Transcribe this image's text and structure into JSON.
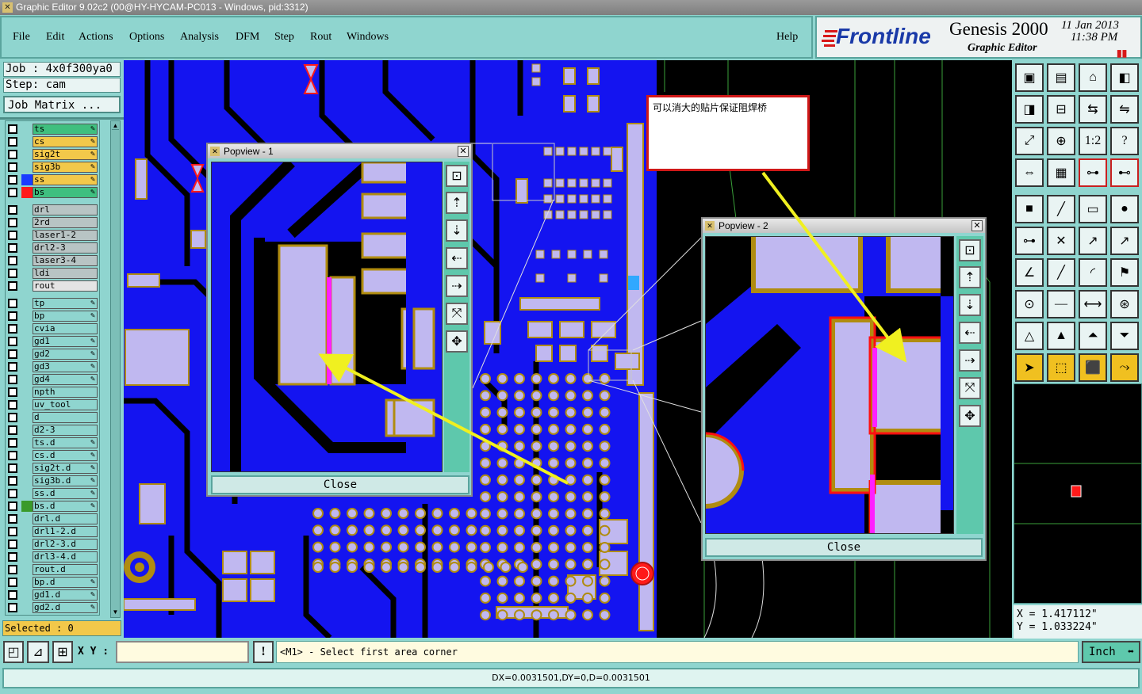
{
  "window_title": "Graphic Editor 9.02c2 (00@HY-HYCAM-PC013 - Windows, pid:3312)",
  "menu": [
    "File",
    "Edit",
    "Actions",
    "Options",
    "Analysis",
    "DFM",
    "Step",
    "Rout",
    "Windows"
  ],
  "help_label": "Help",
  "brand": {
    "logo": "Frontline",
    "product": "Genesis 2000",
    "subtitle": "Graphic Editor",
    "date": "11 Jan 2013",
    "time": "11:38 PM"
  },
  "job": "Job : 4x0f300ya0",
  "step": "Step: cam",
  "job_matrix_label": "Job Matrix ...",
  "layers": [
    {
      "name": "ts",
      "bg": "#3fbf7f",
      "sw": "",
      "ed": true
    },
    {
      "name": "cs",
      "bg": "#f2c84a",
      "sw": "",
      "ed": true
    },
    {
      "name": "sig2t",
      "bg": "#f2c84a",
      "sw": "",
      "ed": true
    },
    {
      "name": "sig3b",
      "bg": "#f2c84a",
      "sw": "",
      "ed": true
    },
    {
      "name": "ss",
      "bg": "#f2c84a",
      "sw": "#1a3cff",
      "ed": true
    },
    {
      "name": "bs",
      "bg": "#3fbf7f",
      "sw": "#ff1a1a",
      "ed": true
    },
    {
      "name": "drl",
      "bg": "#b8c4c4",
      "sw": "",
      "ed": false,
      "gap": true
    },
    {
      "name": "2rd",
      "bg": "#b8c4c4",
      "sw": "",
      "ed": false
    },
    {
      "name": "laser1-2",
      "bg": "#b8c4c4",
      "sw": "",
      "ed": false
    },
    {
      "name": "drl2-3",
      "bg": "#b8c4c4",
      "sw": "",
      "ed": false
    },
    {
      "name": "laser3-4",
      "bg": "#b8c4c4",
      "sw": "",
      "ed": false
    },
    {
      "name": "ldi",
      "bg": "#b8c4c4",
      "sw": "",
      "ed": false
    },
    {
      "name": "rout",
      "bg": "#e4e4e4",
      "sw": "",
      "ed": false
    },
    {
      "name": "tp",
      "bg": "#8fd5cf",
      "sw": "",
      "ed": true,
      "gap": true
    },
    {
      "name": "bp",
      "bg": "#8fd5cf",
      "sw": "",
      "ed": true
    },
    {
      "name": "cvia",
      "bg": "#8fd5cf",
      "sw": "",
      "ed": false
    },
    {
      "name": "gd1",
      "bg": "#8fd5cf",
      "sw": "",
      "ed": true
    },
    {
      "name": "gd2",
      "bg": "#8fd5cf",
      "sw": "",
      "ed": true
    },
    {
      "name": "gd3",
      "bg": "#8fd5cf",
      "sw": "",
      "ed": true
    },
    {
      "name": "gd4",
      "bg": "#8fd5cf",
      "sw": "",
      "ed": true
    },
    {
      "name": "npth",
      "bg": "#8fd5cf",
      "sw": "",
      "ed": false
    },
    {
      "name": "uv_tool",
      "bg": "#8fd5cf",
      "sw": "",
      "ed": false
    },
    {
      "name": "d",
      "bg": "#8fd5cf",
      "sw": "",
      "ed": false
    },
    {
      "name": "d2-3",
      "bg": "#8fd5cf",
      "sw": "",
      "ed": false
    },
    {
      "name": "ts.d",
      "bg": "#8fd5cf",
      "sw": "",
      "ed": true
    },
    {
      "name": "cs.d",
      "bg": "#8fd5cf",
      "sw": "",
      "ed": true
    },
    {
      "name": "sig2t.d",
      "bg": "#8fd5cf",
      "sw": "",
      "ed": true
    },
    {
      "name": "sig3b.d",
      "bg": "#8fd5cf",
      "sw": "",
      "ed": true
    },
    {
      "name": "ss.d",
      "bg": "#8fd5cf",
      "sw": "",
      "ed": true
    },
    {
      "name": "bs.d",
      "bg": "#8fd5cf",
      "sw": "#3a9a2a",
      "ed": true
    },
    {
      "name": "drl.d",
      "bg": "#8fd5cf",
      "sw": "",
      "ed": false
    },
    {
      "name": "drl1-2.d",
      "bg": "#8fd5cf",
      "sw": "",
      "ed": false
    },
    {
      "name": "drl2-3.d",
      "bg": "#8fd5cf",
      "sw": "",
      "ed": false
    },
    {
      "name": "drl3-4.d",
      "bg": "#8fd5cf",
      "sw": "",
      "ed": false
    },
    {
      "name": "rout.d",
      "bg": "#8fd5cf",
      "sw": "",
      "ed": false
    },
    {
      "name": "bp.d",
      "bg": "#8fd5cf",
      "sw": "",
      "ed": true
    },
    {
      "name": "gd1.d",
      "bg": "#8fd5cf",
      "sw": "",
      "ed": true
    },
    {
      "name": "gd2.d",
      "bg": "#8fd5cf",
      "sw": "",
      "ed": true
    }
  ],
  "selected": "Selected : 0",
  "popview1": {
    "title": "Popview - 1",
    "close": "Close"
  },
  "popview2": {
    "title": "Popview - 2",
    "close": "Close"
  },
  "note": "可以消大的贴片保证阻焊桥",
  "coords": {
    "x": "X = 1.417112\"",
    "y": "Y = 1.033224\""
  },
  "bottom": {
    "xy_label": "X Y :",
    "xy_value": "",
    "prompt": "<M1> - Select first area corner",
    "units": "Inch",
    "status": "DX=0.0031501,DY=0,D=0.0031501"
  },
  "colors": {
    "board": "#1414f0",
    "pad": "#c0b8f0",
    "copper": "#b08c10",
    "accent": "#f0f020",
    "magenta": "#ff20ff"
  }
}
